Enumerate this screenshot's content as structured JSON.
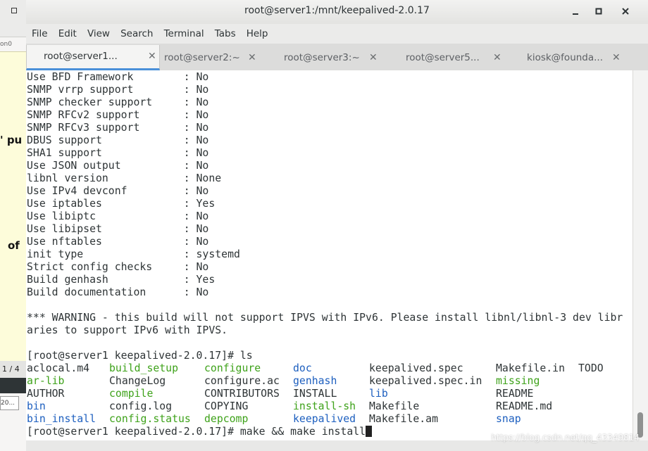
{
  "background_app": {
    "tiny_text": "on0",
    "fragment_1": "' pu",
    "fragment_2": "of",
    "page_indicator": "1 / 4",
    "box_text": "20..."
  },
  "window": {
    "title": "root@server1:/mnt/keepalived-2.0.17",
    "buttons": [
      "menu",
      "minimize",
      "maximize",
      "close"
    ]
  },
  "menu": [
    "File",
    "Edit",
    "View",
    "Search",
    "Terminal",
    "Tabs",
    "Help"
  ],
  "tabs": [
    {
      "label": "root@server1...",
      "active": true
    },
    {
      "label": "root@server2:~",
      "active": false
    },
    {
      "label": "root@server3:~",
      "active": false
    },
    {
      "label": "root@server5...",
      "active": false
    },
    {
      "label": "kiosk@founda...",
      "active": false
    }
  ],
  "terminal": {
    "lines": [
      "Use BFD Framework        : No",
      "SNMP vrrp support        : No",
      "SNMP checker support     : No",
      "SNMP RFCv2 support       : No",
      "SNMP RFCv3 support       : No",
      "DBUS support             : No",
      "SHA1 support             : No",
      "Use JSON output          : No",
      "libnl version            : None",
      "Use IPv4 devconf         : No",
      "Use iptables             : Yes",
      "Use libiptc              : No",
      "Use libipset             : No",
      "Use nftables             : No",
      "init type                : systemd",
      "Strict config checks     : No",
      "Build genhash            : Yes",
      "Build documentation      : No",
      "",
      "*** WARNING - this build will not support IPVS with IPv6. Please install libnl/libnl-3 dev libr",
      "aries to support IPv6 with IPVS.",
      "",
      "[root@server1 keepalived-2.0.17]# ls"
    ],
    "ls_rows": [
      [
        {
          "t": "aclocal.m4",
          "c": "default"
        },
        {
          "t": "build_setup",
          "c": "green"
        },
        {
          "t": "configure",
          "c": "green"
        },
        {
          "t": "doc",
          "c": "blue"
        },
        {
          "t": "keepalived.spec",
          "c": "default"
        },
        {
          "t": "Makefile.in",
          "c": "default"
        },
        {
          "t": "TODO",
          "c": "default"
        }
      ],
      [
        {
          "t": "ar-lib",
          "c": "green"
        },
        {
          "t": "ChangeLog",
          "c": "default"
        },
        {
          "t": "configure.ac",
          "c": "default"
        },
        {
          "t": "genhash",
          "c": "blue"
        },
        {
          "t": "keepalived.spec.in",
          "c": "default"
        },
        {
          "t": "missing",
          "c": "green"
        },
        {
          "t": "",
          "c": "default"
        }
      ],
      [
        {
          "t": "AUTHOR",
          "c": "default"
        },
        {
          "t": "compile",
          "c": "green"
        },
        {
          "t": "CONTRIBUTORS",
          "c": "default"
        },
        {
          "t": "INSTALL",
          "c": "default"
        },
        {
          "t": "lib",
          "c": "blue"
        },
        {
          "t": "README",
          "c": "default"
        },
        {
          "t": "",
          "c": "default"
        }
      ],
      [
        {
          "t": "bin",
          "c": "blue"
        },
        {
          "t": "config.log",
          "c": "default"
        },
        {
          "t": "COPYING",
          "c": "default"
        },
        {
          "t": "install-sh",
          "c": "green"
        },
        {
          "t": "Makefile",
          "c": "default"
        },
        {
          "t": "README.md",
          "c": "default"
        },
        {
          "t": "",
          "c": "default"
        }
      ],
      [
        {
          "t": "bin_install",
          "c": "blue"
        },
        {
          "t": "config.status",
          "c": "green"
        },
        {
          "t": "depcomp",
          "c": "green"
        },
        {
          "t": "keepalived",
          "c": "blue"
        },
        {
          "t": "Makefile.am",
          "c": "default"
        },
        {
          "t": "snap",
          "c": "blue"
        },
        {
          "t": "",
          "c": "default"
        }
      ]
    ],
    "current_command": "[root@server1 keepalived-2.0.17]# make && make install"
  },
  "watermark": "https://blog.csdn.net/qq_43349814",
  "colors": {
    "accent": "#4a90d9",
    "ls_directory": "#1d5fbf",
    "ls_executable": "#3ea21a",
    "text": "#2e3436"
  }
}
